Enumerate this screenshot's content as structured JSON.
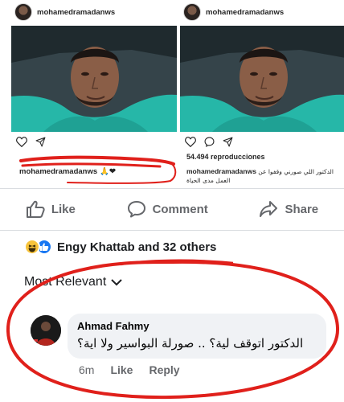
{
  "instagram": {
    "left": {
      "username": "mohamedramadanws",
      "caption_user": "mohamedramadanws",
      "caption_emoji": "🙏❤"
    },
    "right": {
      "username": "mohamedramadanws",
      "views": "54.494 reproducciones",
      "caption_user": "mohamedramadanws",
      "caption_text": "الدكتور اللي صورني وقفوا عن العمل مدى الحياة"
    }
  },
  "actions": {
    "like_label": "Like",
    "comment_label": "Comment",
    "share_label": "Share"
  },
  "reactions": {
    "summary": "Engy Khattab and 32 others"
  },
  "sort": {
    "label": "Most Relevant"
  },
  "comment": {
    "author": "Ahmad Fahmy",
    "text": "الدكتور اتوقف لية؟ .. صورلة البواسير ولا اية؟",
    "time": "6m",
    "like_label": "Like",
    "reply_label": "Reply"
  },
  "colors": {
    "facebook_blue": "#1877f2",
    "muted_text": "#65676b",
    "bubble_bg": "#f0f2f5",
    "annotation_red": "#e0201b"
  }
}
